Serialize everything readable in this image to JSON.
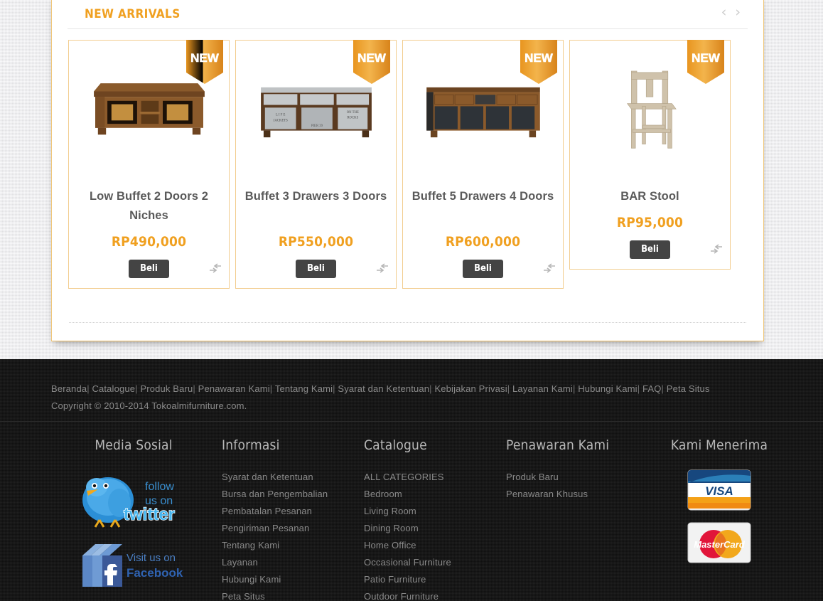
{
  "section": {
    "title": "NEW ARRIVALS",
    "prev_arrow": "‹",
    "next_arrow": "›"
  },
  "products": [
    {
      "badge": "NEW",
      "title": "Low Buffet 2 Doors 2 Niches",
      "price": "RP490,000",
      "buy_label": "Beli",
      "image_name": "low-buffet-2-doors-2-niches"
    },
    {
      "badge": "NEW",
      "title": "Buffet 3 Drawers 3 Doors",
      "price": "RP550,000",
      "buy_label": "Beli",
      "image_name": "buffet-3-drawers-3-doors"
    },
    {
      "badge": "NEW",
      "title": "Buffet 5 Drawers 4 Doors",
      "price": "RP600,000",
      "buy_label": "Beli",
      "image_name": "buffet-5-drawers-4-doors"
    },
    {
      "badge": "NEW",
      "title": "BAR Stool",
      "price": "RP95,000",
      "buy_label": "Beli",
      "image_name": "bar-stool"
    }
  ],
  "footer": {
    "nav_links": [
      "Beranda",
      "Catalogue",
      "Produk Baru",
      "Penawaran Kami",
      "Tentang Kami",
      "Syarat dan Ketentuan",
      "Kebijakan Privasi",
      "Layanan Kami",
      "Hubungi Kami",
      "FAQ",
      "Peta Situs"
    ],
    "separator": "|",
    "copyright": "Copyright © 2010-2014 Tokoalmifurniture.com.",
    "columns": {
      "social": {
        "heading": "Media Sosial",
        "twitter_line1": "follow",
        "twitter_line2": "us on",
        "twitter_word": "twitter",
        "facebook_line1": "Visit us on",
        "facebook_word": "Facebook"
      },
      "informasi": {
        "heading": "Informasi",
        "items": [
          "Syarat dan Ketentuan",
          "Bursa dan Pengembalian",
          "Pembatalan Pesanan",
          "Pengiriman Pesanan",
          "Tentang Kami",
          "Layanan",
          "Hubungi Kami",
          "Peta Situs"
        ]
      },
      "catalogue": {
        "heading": "Catalogue",
        "items": [
          "ALL CATEGORIES",
          "Bedroom",
          "Living Room",
          "Dining Room",
          "Home Office",
          "Occasional Furniture",
          "Patio Furniture",
          "Outdoor Furniture"
        ]
      },
      "penawaran": {
        "heading": "Penawaran Kami",
        "items": [
          "Produk Baru",
          "Penawaran Khusus"
        ]
      },
      "pembayaran": {
        "heading": "Kami Menerima",
        "cards": [
          "VISA",
          "MasterCard"
        ]
      }
    }
  },
  "colors": {
    "accent_orange": "#f0a020",
    "card_border": "#f2cd8f",
    "button_dark": "#444444",
    "footer_bg": "#1a1a1a",
    "title_gray": "#5a5a5a"
  }
}
